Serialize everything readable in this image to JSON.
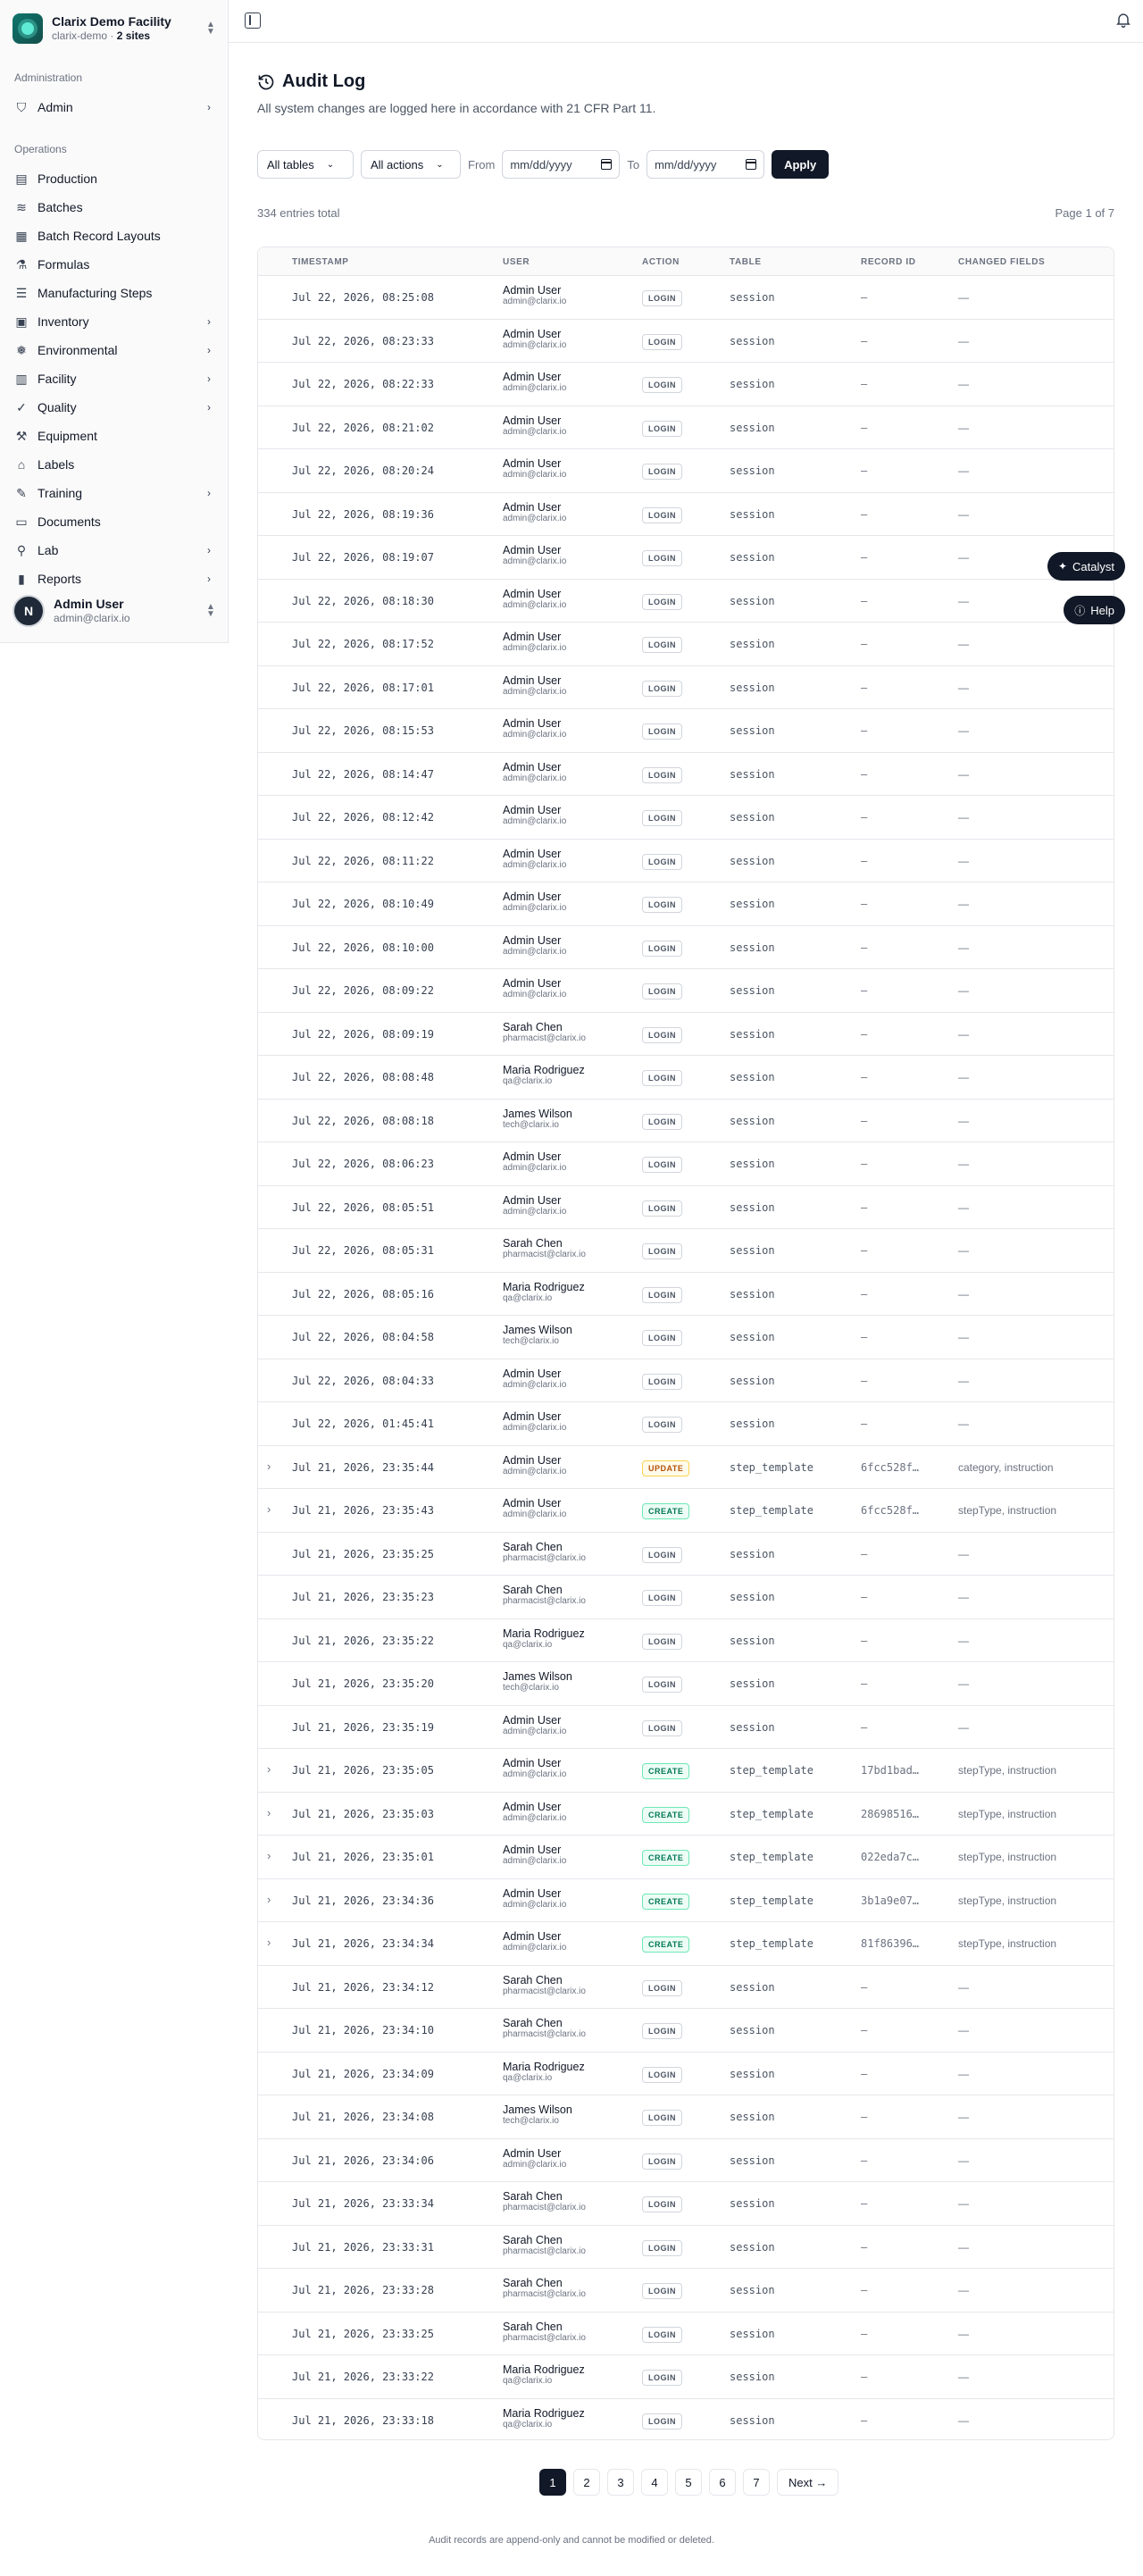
{
  "org": {
    "name": "Clarix Demo Facility",
    "slug": "clarix-demo",
    "sites": "2 sites"
  },
  "nav": {
    "admin_heading": "Administration",
    "admin_items": [
      {
        "label": "Admin",
        "icon": "shield-icon",
        "chevron": true
      }
    ],
    "ops_heading": "Operations",
    "ops_items": [
      {
        "label": "Production",
        "icon": "factory-icon",
        "chevron": false
      },
      {
        "label": "Batches",
        "icon": "layers-icon",
        "chevron": false
      },
      {
        "label": "Batch Record Layouts",
        "icon": "layout-icon",
        "chevron": false
      },
      {
        "label": "Formulas",
        "icon": "flask-icon",
        "chevron": false
      },
      {
        "label": "Manufacturing Steps",
        "icon": "list-steps-icon",
        "chevron": false
      },
      {
        "label": "Inventory",
        "icon": "box-icon",
        "chevron": true
      },
      {
        "label": "Environmental",
        "icon": "thermometer-icon",
        "chevron": true
      },
      {
        "label": "Facility",
        "icon": "building-icon",
        "chevron": true
      },
      {
        "label": "Quality",
        "icon": "shield-check-icon",
        "chevron": true
      },
      {
        "label": "Equipment",
        "icon": "wrench-icon",
        "chevron": false
      },
      {
        "label": "Labels",
        "icon": "tag-icon",
        "chevron": false
      },
      {
        "label": "Training",
        "icon": "graduation-cap-icon",
        "chevron": true
      },
      {
        "label": "Documents",
        "icon": "folder-icon",
        "chevron": false
      },
      {
        "label": "Lab",
        "icon": "microscope-icon",
        "chevron": true
      },
      {
        "label": "Reports",
        "icon": "bar-chart-icon",
        "chevron": true
      }
    ]
  },
  "current_user": {
    "initial": "N",
    "name": "Admin User",
    "email": "admin@clarix.io"
  },
  "page": {
    "title": "Audit Log",
    "subtitle": "All system changes are logged here in accordance with 21 CFR Part 11."
  },
  "filters": {
    "table_select": "All tables",
    "action_select": "All actions",
    "from_label": "From",
    "to_label": "To",
    "from_placeholder": "mm/dd/yyyy",
    "to_placeholder": "mm/dd/yyyy",
    "apply_label": "Apply"
  },
  "summary": {
    "total": "334 entries total",
    "page_info": "Page 1 of 7"
  },
  "columns": [
    "TIMESTAMP",
    "USER",
    "ACTION",
    "TABLE",
    "RECORD ID",
    "CHANGED FIELDS"
  ],
  "rows": [
    {
      "expand": false,
      "ts": "Jul 22, 2026, 08:25:08",
      "user": "Admin User",
      "email": "admin@clarix.io",
      "action": "LOGIN",
      "table": "session",
      "record": "—",
      "fields": "—"
    },
    {
      "expand": false,
      "ts": "Jul 22, 2026, 08:23:33",
      "user": "Admin User",
      "email": "admin@clarix.io",
      "action": "LOGIN",
      "table": "session",
      "record": "—",
      "fields": "—"
    },
    {
      "expand": false,
      "ts": "Jul 22, 2026, 08:22:33",
      "user": "Admin User",
      "email": "admin@clarix.io",
      "action": "LOGIN",
      "table": "session",
      "record": "—",
      "fields": "—"
    },
    {
      "expand": false,
      "ts": "Jul 22, 2026, 08:21:02",
      "user": "Admin User",
      "email": "admin@clarix.io",
      "action": "LOGIN",
      "table": "session",
      "record": "—",
      "fields": "—"
    },
    {
      "expand": false,
      "ts": "Jul 22, 2026, 08:20:24",
      "user": "Admin User",
      "email": "admin@clarix.io",
      "action": "LOGIN",
      "table": "session",
      "record": "—",
      "fields": "—"
    },
    {
      "expand": false,
      "ts": "Jul 22, 2026, 08:19:36",
      "user": "Admin User",
      "email": "admin@clarix.io",
      "action": "LOGIN",
      "table": "session",
      "record": "—",
      "fields": "—"
    },
    {
      "expand": false,
      "ts": "Jul 22, 2026, 08:19:07",
      "user": "Admin User",
      "email": "admin@clarix.io",
      "action": "LOGIN",
      "table": "session",
      "record": "—",
      "fields": "—"
    },
    {
      "expand": false,
      "ts": "Jul 22, 2026, 08:18:30",
      "user": "Admin User",
      "email": "admin@clarix.io",
      "action": "LOGIN",
      "table": "session",
      "record": "—",
      "fields": "—"
    },
    {
      "expand": false,
      "ts": "Jul 22, 2026, 08:17:52",
      "user": "Admin User",
      "email": "admin@clarix.io",
      "action": "LOGIN",
      "table": "session",
      "record": "—",
      "fields": "—"
    },
    {
      "expand": false,
      "ts": "Jul 22, 2026, 08:17:01",
      "user": "Admin User",
      "email": "admin@clarix.io",
      "action": "LOGIN",
      "table": "session",
      "record": "—",
      "fields": "—"
    },
    {
      "expand": false,
      "ts": "Jul 22, 2026, 08:15:53",
      "user": "Admin User",
      "email": "admin@clarix.io",
      "action": "LOGIN",
      "table": "session",
      "record": "—",
      "fields": "—"
    },
    {
      "expand": false,
      "ts": "Jul 22, 2026, 08:14:47",
      "user": "Admin User",
      "email": "admin@clarix.io",
      "action": "LOGIN",
      "table": "session",
      "record": "—",
      "fields": "—"
    },
    {
      "expand": false,
      "ts": "Jul 22, 2026, 08:12:42",
      "user": "Admin User",
      "email": "admin@clarix.io",
      "action": "LOGIN",
      "table": "session",
      "record": "—",
      "fields": "—"
    },
    {
      "expand": false,
      "ts": "Jul 22, 2026, 08:11:22",
      "user": "Admin User",
      "email": "admin@clarix.io",
      "action": "LOGIN",
      "table": "session",
      "record": "—",
      "fields": "—"
    },
    {
      "expand": false,
      "ts": "Jul 22, 2026, 08:10:49",
      "user": "Admin User",
      "email": "admin@clarix.io",
      "action": "LOGIN",
      "table": "session",
      "record": "—",
      "fields": "—"
    },
    {
      "expand": false,
      "ts": "Jul 22, 2026, 08:10:00",
      "user": "Admin User",
      "email": "admin@clarix.io",
      "action": "LOGIN",
      "table": "session",
      "record": "—",
      "fields": "—"
    },
    {
      "expand": false,
      "ts": "Jul 22, 2026, 08:09:22",
      "user": "Admin User",
      "email": "admin@clarix.io",
      "action": "LOGIN",
      "table": "session",
      "record": "—",
      "fields": "—"
    },
    {
      "expand": false,
      "ts": "Jul 22, 2026, 08:09:19",
      "user": "Sarah Chen",
      "email": "pharmacist@clarix.io",
      "action": "LOGIN",
      "table": "session",
      "record": "—",
      "fields": "—"
    },
    {
      "expand": false,
      "ts": "Jul 22, 2026, 08:08:48",
      "user": "Maria Rodriguez",
      "email": "qa@clarix.io",
      "action": "LOGIN",
      "table": "session",
      "record": "—",
      "fields": "—"
    },
    {
      "expand": false,
      "ts": "Jul 22, 2026, 08:08:18",
      "user": "James Wilson",
      "email": "tech@clarix.io",
      "action": "LOGIN",
      "table": "session",
      "record": "—",
      "fields": "—"
    },
    {
      "expand": false,
      "ts": "Jul 22, 2026, 08:06:23",
      "user": "Admin User",
      "email": "admin@clarix.io",
      "action": "LOGIN",
      "table": "session",
      "record": "—",
      "fields": "—"
    },
    {
      "expand": false,
      "ts": "Jul 22, 2026, 08:05:51",
      "user": "Admin User",
      "email": "admin@clarix.io",
      "action": "LOGIN",
      "table": "session",
      "record": "—",
      "fields": "—"
    },
    {
      "expand": false,
      "ts": "Jul 22, 2026, 08:05:31",
      "user": "Sarah Chen",
      "email": "pharmacist@clarix.io",
      "action": "LOGIN",
      "table": "session",
      "record": "—",
      "fields": "—"
    },
    {
      "expand": false,
      "ts": "Jul 22, 2026, 08:05:16",
      "user": "Maria Rodriguez",
      "email": "qa@clarix.io",
      "action": "LOGIN",
      "table": "session",
      "record": "—",
      "fields": "—"
    },
    {
      "expand": false,
      "ts": "Jul 22, 2026, 08:04:58",
      "user": "James Wilson",
      "email": "tech@clarix.io",
      "action": "LOGIN",
      "table": "session",
      "record": "—",
      "fields": "—"
    },
    {
      "expand": false,
      "ts": "Jul 22, 2026, 08:04:33",
      "user": "Admin User",
      "email": "admin@clarix.io",
      "action": "LOGIN",
      "table": "session",
      "record": "—",
      "fields": "—"
    },
    {
      "expand": false,
      "ts": "Jul 22, 2026, 01:45:41",
      "user": "Admin User",
      "email": "admin@clarix.io",
      "action": "LOGIN",
      "table": "session",
      "record": "—",
      "fields": "—"
    },
    {
      "expand": true,
      "ts": "Jul 21, 2026, 23:35:44",
      "user": "Admin User",
      "email": "admin@clarix.io",
      "action": "UPDATE",
      "table": "step_template",
      "record": "6fcc528f…",
      "fields": "category, instruction"
    },
    {
      "expand": true,
      "ts": "Jul 21, 2026, 23:35:43",
      "user": "Admin User",
      "email": "admin@clarix.io",
      "action": "CREATE",
      "table": "step_template",
      "record": "6fcc528f…",
      "fields": "stepType, instruction"
    },
    {
      "expand": false,
      "ts": "Jul 21, 2026, 23:35:25",
      "user": "Sarah Chen",
      "email": "pharmacist@clarix.io",
      "action": "LOGIN",
      "table": "session",
      "record": "—",
      "fields": "—"
    },
    {
      "expand": false,
      "ts": "Jul 21, 2026, 23:35:23",
      "user": "Sarah Chen",
      "email": "pharmacist@clarix.io",
      "action": "LOGIN",
      "table": "session",
      "record": "—",
      "fields": "—"
    },
    {
      "expand": false,
      "ts": "Jul 21, 2026, 23:35:22",
      "user": "Maria Rodriguez",
      "email": "qa@clarix.io",
      "action": "LOGIN",
      "table": "session",
      "record": "—",
      "fields": "—"
    },
    {
      "expand": false,
      "ts": "Jul 21, 2026, 23:35:20",
      "user": "James Wilson",
      "email": "tech@clarix.io",
      "action": "LOGIN",
      "table": "session",
      "record": "—",
      "fields": "—"
    },
    {
      "expand": false,
      "ts": "Jul 21, 2026, 23:35:19",
      "user": "Admin User",
      "email": "admin@clarix.io",
      "action": "LOGIN",
      "table": "session",
      "record": "—",
      "fields": "—"
    },
    {
      "expand": true,
      "ts": "Jul 21, 2026, 23:35:05",
      "user": "Admin User",
      "email": "admin@clarix.io",
      "action": "CREATE",
      "table": "step_template",
      "record": "17bd1bad…",
      "fields": "stepType, instruction"
    },
    {
      "expand": true,
      "ts": "Jul 21, 2026, 23:35:03",
      "user": "Admin User",
      "email": "admin@clarix.io",
      "action": "CREATE",
      "table": "step_template",
      "record": "28698516…",
      "fields": "stepType, instruction"
    },
    {
      "expand": true,
      "ts": "Jul 21, 2026, 23:35:01",
      "user": "Admin User",
      "email": "admin@clarix.io",
      "action": "CREATE",
      "table": "step_template",
      "record": "022eda7c…",
      "fields": "stepType, instruction"
    },
    {
      "expand": true,
      "ts": "Jul 21, 2026, 23:34:36",
      "user": "Admin User",
      "email": "admin@clarix.io",
      "action": "CREATE",
      "table": "step_template",
      "record": "3b1a9e07…",
      "fields": "stepType, instruction"
    },
    {
      "expand": true,
      "ts": "Jul 21, 2026, 23:34:34",
      "user": "Admin User",
      "email": "admin@clarix.io",
      "action": "CREATE",
      "table": "step_template",
      "record": "81f86396…",
      "fields": "stepType, instruction"
    },
    {
      "expand": false,
      "ts": "Jul 21, 2026, 23:34:12",
      "user": "Sarah Chen",
      "email": "pharmacist@clarix.io",
      "action": "LOGIN",
      "table": "session",
      "record": "—",
      "fields": "—"
    },
    {
      "expand": false,
      "ts": "Jul 21, 2026, 23:34:10",
      "user": "Sarah Chen",
      "email": "pharmacist@clarix.io",
      "action": "LOGIN",
      "table": "session",
      "record": "—",
      "fields": "—"
    },
    {
      "expand": false,
      "ts": "Jul 21, 2026, 23:34:09",
      "user": "Maria Rodriguez",
      "email": "qa@clarix.io",
      "action": "LOGIN",
      "table": "session",
      "record": "—",
      "fields": "—"
    },
    {
      "expand": false,
      "ts": "Jul 21, 2026, 23:34:08",
      "user": "James Wilson",
      "email": "tech@clarix.io",
      "action": "LOGIN",
      "table": "session",
      "record": "—",
      "fields": "—"
    },
    {
      "expand": false,
      "ts": "Jul 21, 2026, 23:34:06",
      "user": "Admin User",
      "email": "admin@clarix.io",
      "action": "LOGIN",
      "table": "session",
      "record": "—",
      "fields": "—"
    },
    {
      "expand": false,
      "ts": "Jul 21, 2026, 23:33:34",
      "user": "Sarah Chen",
      "email": "pharmacist@clarix.io",
      "action": "LOGIN",
      "table": "session",
      "record": "—",
      "fields": "—"
    },
    {
      "expand": false,
      "ts": "Jul 21, 2026, 23:33:31",
      "user": "Sarah Chen",
      "email": "pharmacist@clarix.io",
      "action": "LOGIN",
      "table": "session",
      "record": "—",
      "fields": "—"
    },
    {
      "expand": false,
      "ts": "Jul 21, 2026, 23:33:28",
      "user": "Sarah Chen",
      "email": "pharmacist@clarix.io",
      "action": "LOGIN",
      "table": "session",
      "record": "—",
      "fields": "—"
    },
    {
      "expand": false,
      "ts": "Jul 21, 2026, 23:33:25",
      "user": "Sarah Chen",
      "email": "pharmacist@clarix.io",
      "action": "LOGIN",
      "table": "session",
      "record": "—",
      "fields": "—"
    },
    {
      "expand": false,
      "ts": "Jul 21, 2026, 23:33:22",
      "user": "Maria Rodriguez",
      "email": "qa@clarix.io",
      "action": "LOGIN",
      "table": "session",
      "record": "—",
      "fields": "—"
    },
    {
      "expand": false,
      "ts": "Jul 21, 2026, 23:33:18",
      "user": "Maria Rodriguez",
      "email": "qa@clarix.io",
      "action": "LOGIN",
      "table": "session",
      "record": "—",
      "fields": "—"
    }
  ],
  "pagination": {
    "pages": [
      "1",
      "2",
      "3",
      "4",
      "5",
      "6",
      "7"
    ],
    "active": "1",
    "next_label": "Next →"
  },
  "footer": {
    "note": "Audit records are append-only and cannot be modified or deleted."
  },
  "floating": {
    "catalyst_label": "Catalyst",
    "help_label": "Help"
  },
  "colors": {
    "primary": "#111827",
    "create": "#047857",
    "update": "#b45309",
    "border": "#e5e7eb"
  }
}
